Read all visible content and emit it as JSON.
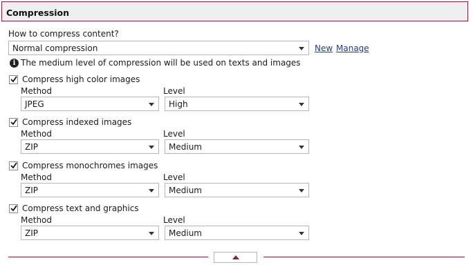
{
  "header": {
    "title": "Compression"
  },
  "content": {
    "question_label": "How to compress content?",
    "mode_value": "Normal compression",
    "new_link": "New",
    "manage_link": "Manage",
    "info_text": "The medium level of compression will be used on texts and images"
  },
  "groups": [
    {
      "checkbox_label": "Compress high color images",
      "checked": true,
      "method_label": "Method",
      "method_value": "JPEG",
      "level_label": "Level",
      "level_value": "High"
    },
    {
      "checkbox_label": "Compress indexed images",
      "checked": true,
      "method_label": "Method",
      "method_value": "ZIP",
      "level_label": "Level",
      "level_value": "Medium"
    },
    {
      "checkbox_label": "Compress monochromes images",
      "checked": true,
      "method_label": "Method",
      "method_value": "ZIP",
      "level_label": "Level",
      "level_value": "Medium"
    },
    {
      "checkbox_label": "Compress text and graphics",
      "checked": true,
      "method_label": "Method",
      "method_value": "ZIP",
      "level_label": "Level",
      "level_value": "Medium"
    }
  ],
  "icons": {
    "info": "info-icon",
    "check": "checkmark-icon",
    "dropdown": "chevron-down-icon",
    "collapse": "chevron-up-icon"
  },
  "colors": {
    "accent": "#8b1c3c",
    "header_bg": "#efefef",
    "link": "#1a3f99"
  }
}
